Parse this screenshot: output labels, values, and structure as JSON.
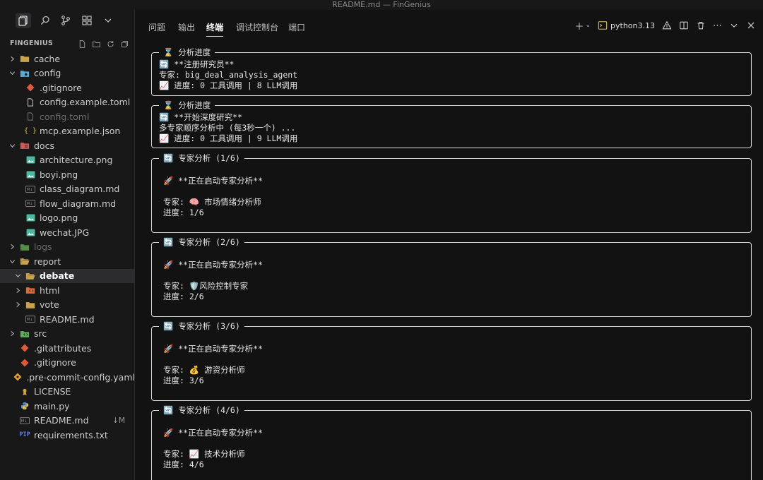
{
  "window": {
    "title": "README.md — FinGenius"
  },
  "explorer": {
    "title": "FINGENIUS",
    "tree": [
      {
        "label": "cache",
        "type": "folder",
        "depth": 0,
        "expanded": false,
        "icon": "folder-icon",
        "color": "#c9a24a"
      },
      {
        "label": "config",
        "type": "folder",
        "depth": 0,
        "expanded": true,
        "icon": "folder-config-icon",
        "color": "#5aa9d6"
      },
      {
        "label": ".gitignore",
        "type": "file",
        "depth": 1,
        "icon": "git-icon",
        "color": "#e05a3a"
      },
      {
        "label": "config.example.toml",
        "type": "file",
        "depth": 1,
        "icon": "file-icon",
        "color": "#cccccc"
      },
      {
        "label": "config.toml",
        "type": "file",
        "depth": 1,
        "icon": "file-icon",
        "color": "#777777",
        "dim": true
      },
      {
        "label": "mcp.example.json",
        "type": "file",
        "depth": 1,
        "icon": "json-icon",
        "color": "#e3c14d"
      },
      {
        "label": "docs",
        "type": "folder",
        "depth": 0,
        "expanded": true,
        "icon": "folder-docs-icon",
        "color": "#d05a5a"
      },
      {
        "label": "architecture.png",
        "type": "file",
        "depth": 1,
        "icon": "image-icon",
        "color": "#4fb6a0"
      },
      {
        "label": "boyi.png",
        "type": "file",
        "depth": 1,
        "icon": "image-icon",
        "color": "#4fb6a0"
      },
      {
        "label": "class_diagram.md",
        "type": "file",
        "depth": 1,
        "icon": "markdown-icon",
        "color": "#8a8a8a"
      },
      {
        "label": "flow_diagram.md",
        "type": "file",
        "depth": 1,
        "icon": "markdown-icon",
        "color": "#8a8a8a"
      },
      {
        "label": "logo.png",
        "type": "file",
        "depth": 1,
        "icon": "image-icon",
        "color": "#4fb6a0"
      },
      {
        "label": "wechat.JPG",
        "type": "file",
        "depth": 1,
        "icon": "image-icon",
        "color": "#4fb6a0"
      },
      {
        "label": "logs",
        "type": "folder",
        "depth": 0,
        "expanded": false,
        "icon": "folder-logs-icon",
        "color": "#6fbf5a",
        "dim": true
      },
      {
        "label": "report",
        "type": "folder",
        "depth": 0,
        "expanded": true,
        "icon": "folder-open-icon",
        "color": "#c9a24a"
      },
      {
        "label": "debate",
        "type": "folder",
        "depth": 1,
        "expanded": true,
        "icon": "folder-open-icon",
        "color": "#c9a24a",
        "selected": true
      },
      {
        "label": "html",
        "type": "folder",
        "depth": 1,
        "expanded": false,
        "icon": "folder-html-icon",
        "color": "#e06a3a"
      },
      {
        "label": "vote",
        "type": "folder",
        "depth": 1,
        "expanded": false,
        "icon": "folder-icon",
        "color": "#c9a24a"
      },
      {
        "label": "README.md",
        "type": "file",
        "depth": 1,
        "icon": "markdown-icon",
        "color": "#8a8a8a"
      },
      {
        "label": "src",
        "type": "folder",
        "depth": 0,
        "expanded": false,
        "icon": "folder-src-icon",
        "color": "#5ab05a"
      },
      {
        "label": ".gitattributes",
        "type": "file",
        "depth": 0,
        "icon": "git-icon",
        "color": "#e05a3a"
      },
      {
        "label": ".gitignore",
        "type": "file",
        "depth": 0,
        "icon": "git-icon",
        "color": "#e05a3a"
      },
      {
        "label": ".pre-commit-config.yaml",
        "type": "file",
        "depth": 0,
        "icon": "precommit-icon",
        "color": "#e0a030"
      },
      {
        "label": "LICENSE",
        "type": "file",
        "depth": 0,
        "icon": "license-icon",
        "color": "#d0a040"
      },
      {
        "label": "main.py",
        "type": "file",
        "depth": 0,
        "icon": "python-icon",
        "color": "#4a8fd6"
      },
      {
        "label": "README.md",
        "type": "file",
        "depth": 0,
        "icon": "markdown-icon",
        "color": "#8a8a8a",
        "badge": "↓M"
      },
      {
        "label": "requirements.txt",
        "type": "file",
        "depth": 0,
        "icon": "pip-icon",
        "color": "#5a7ad6"
      }
    ]
  },
  "panel": {
    "tabs": [
      "问题",
      "输出",
      "终端",
      "调试控制台",
      "端口"
    ],
    "active_tab": 2,
    "python_label": "python3.13"
  },
  "terminal": {
    "boxes": [
      {
        "legend": "⌛ 分析进度",
        "lines": [
          "🔄 **注册研究员**",
          "专家: big_deal_analysis_agent",
          "📈 进度: 0 工具调用 | 8 LLM调用"
        ]
      },
      {
        "legend": "⌛ 分析进度",
        "lines": [
          "🔄 **开始深度研究**",
          "多专家顺序分析中 (每3秒一个) ...",
          "📈 进度: 0 工具调用 | 9 LLM调用"
        ]
      },
      {
        "legend": "🔄 专家分析 (1/6)",
        "lines": [
          "🚀 **正在启动专家分析**",
          "",
          "专家: 🧠 市场情绪分析师",
          "进度: 1/6"
        ]
      },
      {
        "legend": "🔄 专家分析 (2/6)",
        "lines": [
          "🚀 **正在启动专家分析**",
          "",
          "专家: 🛡️风险控制专家",
          "进度: 2/6"
        ]
      },
      {
        "legend": "🔄 专家分析 (3/6)",
        "lines": [
          "🚀 **正在启动专家分析**",
          "",
          "专家: 💰 游资分析师",
          "进度: 3/6"
        ]
      },
      {
        "legend": "🔄 专家分析 (4/6)",
        "lines": [
          "🚀 **正在启动专家分析**",
          "",
          "专家: 📈 技术分析师",
          "进度: 4/6"
        ]
      }
    ]
  }
}
